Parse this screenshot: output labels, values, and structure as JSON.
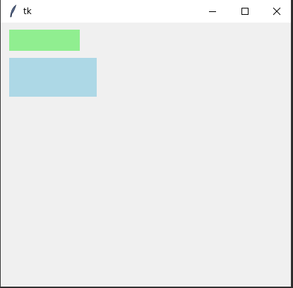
{
  "window": {
    "title": "tk",
    "app_icon": "feather-icon"
  },
  "titlebar_buttons": {
    "minimize_icon": "minimize-icon",
    "maximize_icon": "maximize-icon",
    "close_icon": "close-icon"
  },
  "colors": {
    "titlebar": "#ffffff",
    "client_background": "#f0f0f0",
    "green_box": "#90ee90",
    "blue_box": "#add8e6"
  }
}
